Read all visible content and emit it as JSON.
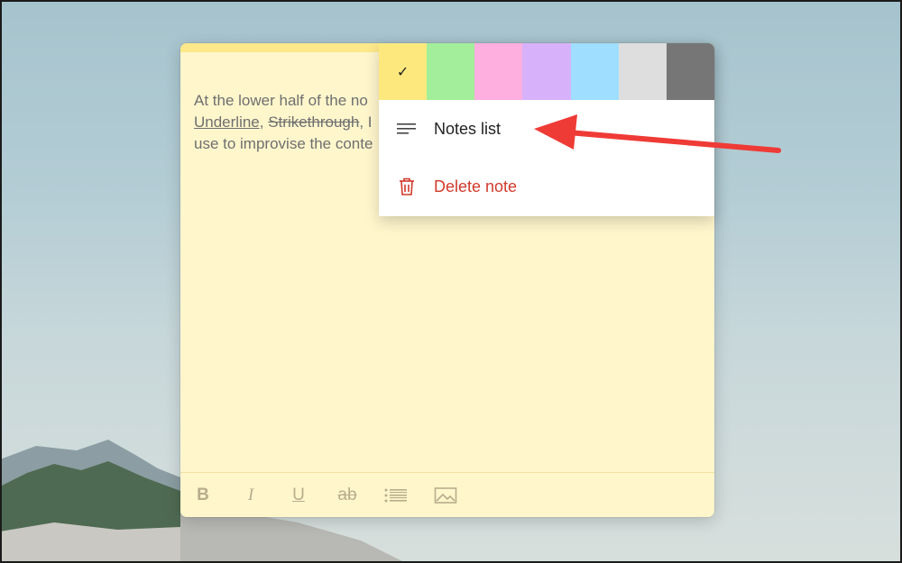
{
  "note": {
    "body_line1": "At the lower half of the no",
    "body_line2_underline": "Underline",
    "body_line2_sep1": ", ",
    "body_line2_strike": "Strikethrough",
    "body_line2_rest": ", I",
    "body_line3": "use to improvise the conte",
    "toolbar": {
      "bold_label": "B",
      "italic_label": "I",
      "underline_label": "U",
      "strike_label": "ab"
    }
  },
  "menu": {
    "selected_color_check": "✓",
    "swatches": [
      {
        "name": "yellow",
        "color": "#fde87e",
        "selected": true
      },
      {
        "name": "green",
        "color": "#a3ee9a"
      },
      {
        "name": "pink",
        "color": "#feaedf"
      },
      {
        "name": "purple",
        "color": "#d7b2fb"
      },
      {
        "name": "blue",
        "color": "#9fdefe"
      },
      {
        "name": "gray",
        "color": "#dedede"
      },
      {
        "name": "charcoal",
        "color": "#767676"
      }
    ],
    "items": [
      {
        "label": "Notes list",
        "icon": "list-icon"
      },
      {
        "label": "Delete note",
        "icon": "trash-icon"
      }
    ]
  },
  "annotation": {
    "color": "#ef3b36"
  }
}
